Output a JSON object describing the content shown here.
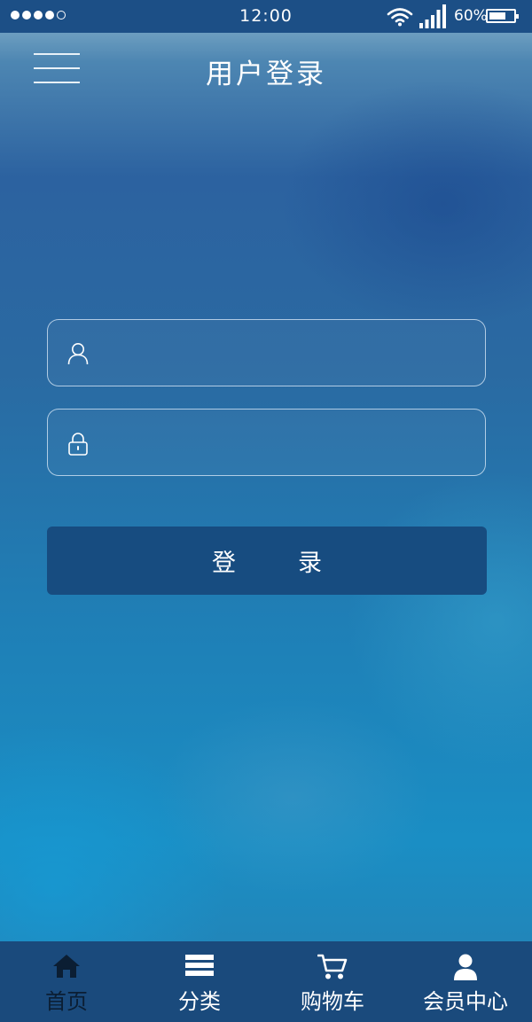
{
  "status_bar": {
    "signal_dots_filled": 4,
    "signal_dots_total": 5,
    "time": "12:00",
    "battery_percent": "60%",
    "icons": [
      "signal-dots-icon",
      "wifi-icon",
      "cellular-signal-icon",
      "battery-icon"
    ]
  },
  "header": {
    "title": "用户登录",
    "menu_icon": "hamburger-menu-icon"
  },
  "form": {
    "username": {
      "icon": "user-icon",
      "value": "",
      "placeholder": ""
    },
    "password": {
      "icon": "lock-icon",
      "value": "",
      "placeholder": ""
    },
    "login_char_1": "登",
    "login_char_2": "录"
  },
  "tab_bar": {
    "active": "home",
    "tabs": [
      {
        "id": "home",
        "label": "首页",
        "icon": "home-icon"
      },
      {
        "id": "category",
        "label": "分类",
        "icon": "list-icon"
      },
      {
        "id": "cart",
        "label": "购物车",
        "icon": "cart-icon"
      },
      {
        "id": "member",
        "label": "会员中心",
        "icon": "person-icon"
      }
    ]
  },
  "colors": {
    "status_bar_bg": "#1c4f86",
    "button_bg": "#174c80",
    "tab_bar_bg": "#1a4a7c",
    "active_tab_text": "#0b1e33"
  }
}
